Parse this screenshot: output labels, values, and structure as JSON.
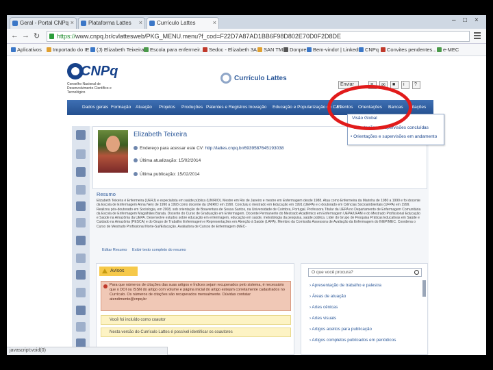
{
  "browser": {
    "tabs": [
      {
        "label": "Geral - Portal CNPq",
        "active": false
      },
      {
        "label": "Plataforma Lattes",
        "active": false
      },
      {
        "label": "Currículo Lattes",
        "active": true
      }
    ],
    "url_scheme": "https://",
    "url_rest": "www.cnpq.br/cvlattesweb/PKG_MENU.menu?f_cod=F22D7A87AD1BB6F98D802E70D0F2D8DE",
    "bookmarks": [
      "Aplicativos",
      "Importado do IE",
      "(J) Elizabeth Teixeira",
      "Escola para enfermeir...",
      "Sedoc - Elizabeth 3A...",
      "SAN TM",
      "Donpre",
      "Bem-vindo! | LinkedIn",
      "CNPq",
      "Convites pendentes...",
      "e-MEC"
    ]
  },
  "header": {
    "logo_text": "CNPq",
    "logo_sub": "Conselho Nacional de Desenvolvimento Científico e Tecnológico",
    "lattes_title": "Currículo Lattes",
    "tools": [
      "Enviar",
      "≡",
      "✉",
      "■",
      "i",
      "?"
    ]
  },
  "nav": {
    "items": [
      "Dados gerais",
      "Formação",
      "Atuação",
      "Projetos",
      "Produções",
      "Patentes e Registros",
      "Inovação",
      "Educação e Popularização de C&T",
      "Eventos",
      "Orientações",
      "Bancas",
      "Citações"
    ]
  },
  "dropdown": {
    "title": "Visão Global",
    "items": [
      "• Orientações e supervisões concluídas",
      "• Orientações e supervisões em andamento"
    ]
  },
  "profile": {
    "name": "Elizabeth Teixeira",
    "address_label": "Endereço para acessar este CV:",
    "address_value": "http://lattes.cnpq.br/6939587645193038",
    "updated_label": "Última atualização:",
    "updated_value": "15/02/2014",
    "published_label": "Última publicação:",
    "published_value": "15/02/2014"
  },
  "resumo": {
    "title": "Resumo",
    "text": "Elizabeth Teixeira é Enfermeira (UERJ) e especialista em saúde pública (UNIRIO). Mestre em Rio de Janeiro e mestre em Enfermagem desde 1988. Atua como Enfermeira da Marinha de 1980 a 1990 e foi docente da Escola de Enfermagem Anna Nery de 1990 a 1993 como docente da UNIRIO em 1990. Concluiu o mestrado em Educação em 1991 (UEPA) e o doutorado em Ciências Socioambientais (UFPA) em 1999. Realizou pós-doutorado em Sociologia, em 2008, sob orientação de Boaventura de Sousa Santos, na Universidade de Coimbra, Portugal. Professora Titular da UEPA no Departamento de Enfermagem Comunitária da Escola de Enfermagem Magalhães Barata. Docente do Curso de Graduação em Enfermagem. Docente Permanente do Mestrado Acadêmico em Enfermagem UEPA/UFAM e do Mestrado Profissional Educação e Saúde na Amazônia da UEPA. Desenvolve estudos sobre educação em enfermagem, educação em saúde, metodologia da pesquisa, saúde pública. Líder do Grupo de Pesquisa Práticas Educativas em Saúde e Cuidado na Amazônia (PESCA) e do Grupo de Trabalho Enfermagem e Representações em Atenção à Saúde (LAPA). Membro da Comissão Assessora de Avaliação da Enfermagem do INEP/MEC. Coordena o Curso de Mestrado Profissional Norte-Sul/Educação. Avaliadora de Cursos de Enfermagem (MEC-",
    "edit_link": "Editar Resumo",
    "expand_link": "Exibir texto completo do resumo"
  },
  "avisos": {
    "title": "Avisos",
    "alert": "Para que números de citações das suas artigos e Índices sejam recuperados pelo sistema, é necessário que o DOI ou ISSN do artigo com volume e página inicial do artigo estejam corretamente cadastrados no Currículo. Os números de citações são recuperados mensalmente. Dúvidas contatar atendimento@cnpq.br",
    "row1": "Você foi incluído como coautor",
    "row2": "Nesta versão do Currículo Lattes é possível identificar os coautores"
  },
  "search": {
    "placeholder": "O que você procura?",
    "links": [
      "Apresentação de trabalho e palestra",
      "Áreas de atuação",
      "Artes cênicas",
      "Artes visuais",
      "Artigos aceitos para publicação",
      "Artigos completos publicados em periódicos"
    ]
  },
  "status_bar": "javascript:void(0)",
  "colors": {
    "nav": "#2a5a9b",
    "highlight_circle": "#e11b1b",
    "alert_bg": "#f0c8b6",
    "notice_bg": "#fdf3c4"
  }
}
